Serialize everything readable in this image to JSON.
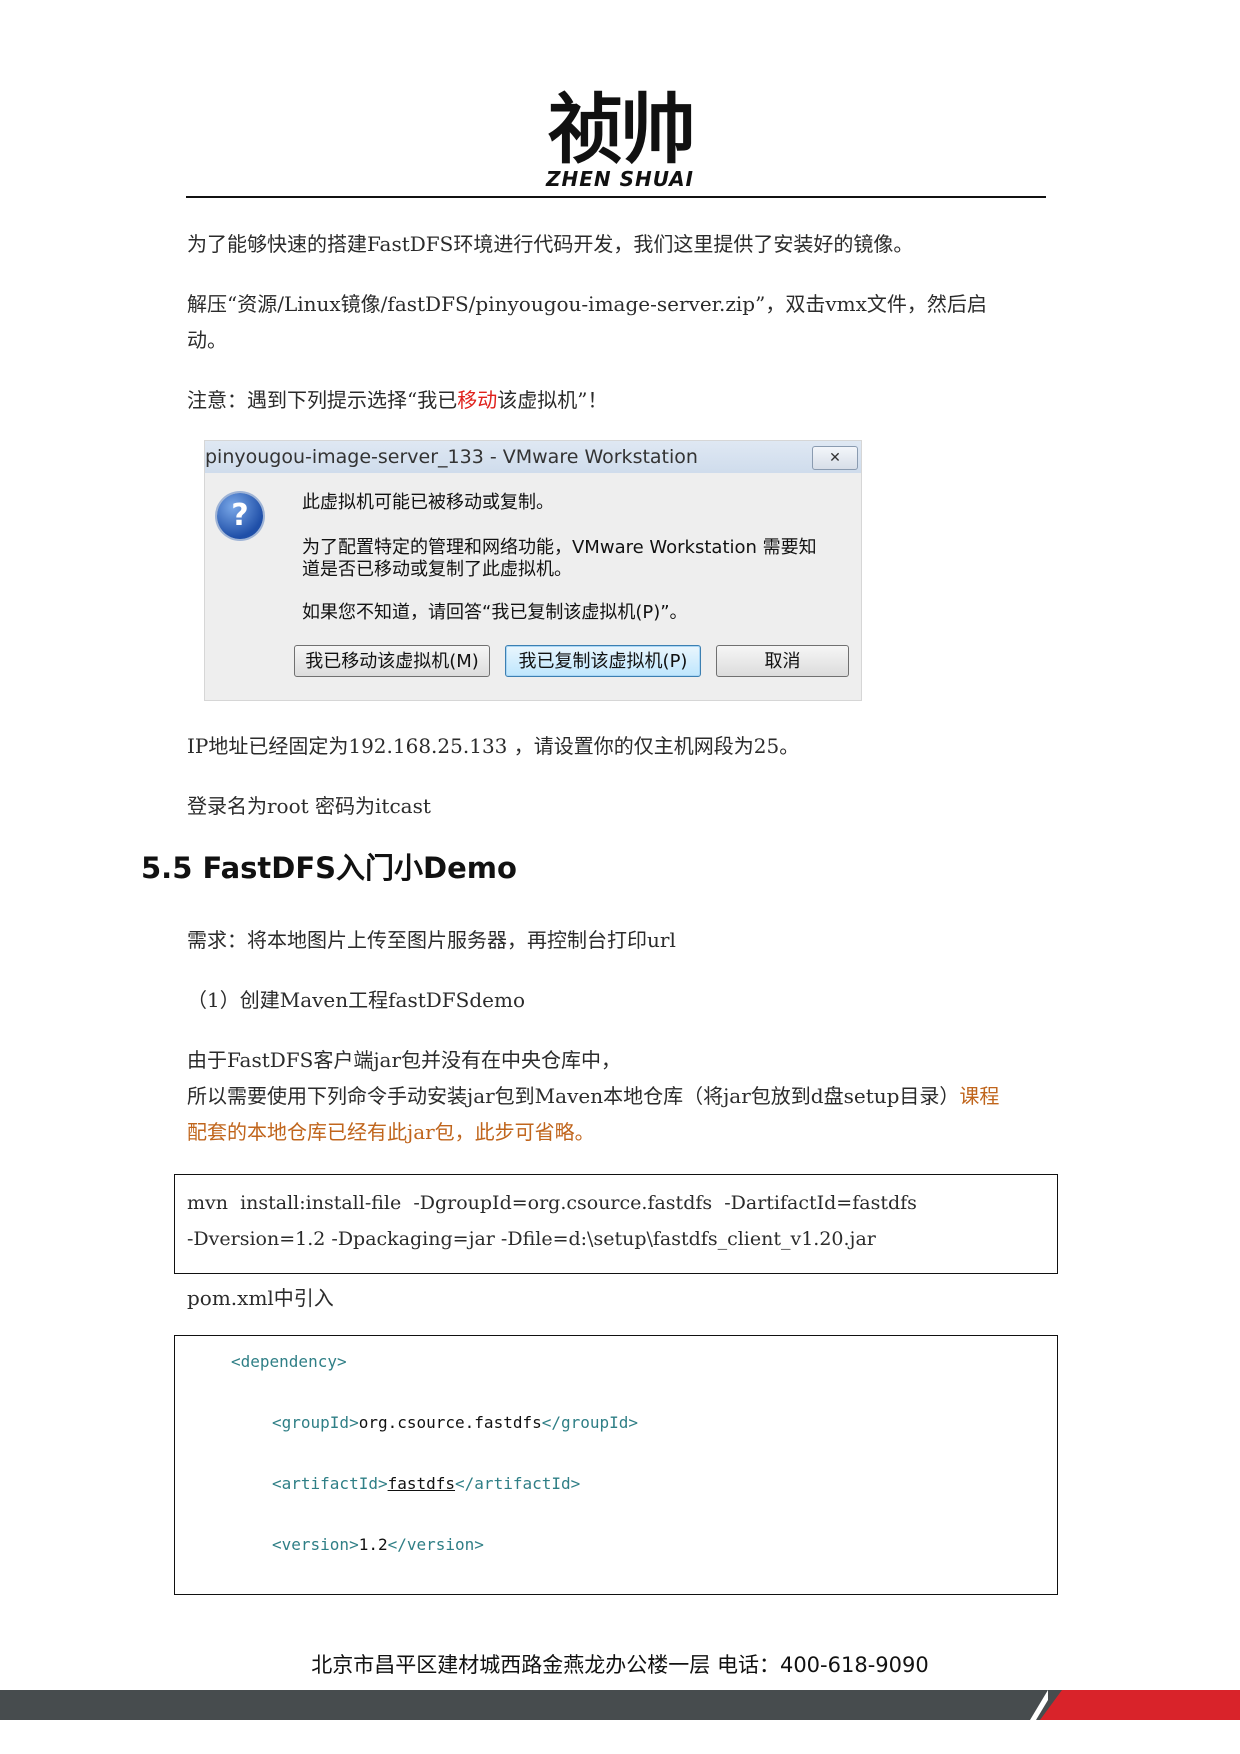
{
  "header": {
    "logo_cn": "祯帅",
    "logo_en": "ZHEN SHUAI"
  },
  "paras": {
    "p1": "为了能够快速的搭建FastDFS环境进行代码开发，我们这里提供了安装好的镜像。",
    "p2a": "解压“资源/Linux镜像/fastDFS/pinyougou-image-server.zip”，双击vmx文件，然后启",
    "p2b": "动。",
    "p3_pre": "注意：遇到下列提示选择“我已",
    "p3_red": "移动",
    "p3_post": "该虚拟机”！",
    "p4": "IP地址已经固定为192.168.25.133  ，请设置你的仅主机网段为25。",
    "p5": "登录名为root  密码为itcast",
    "p6": "需求：将本地图片上传至图片服务器，再控制台打印url",
    "p7": "（1）创建Maven工程fastDFSdemo",
    "p8a": "由于FastDFS客户端jar包并没有在中央仓库中，",
    "p8b_pre": "所以需要使用下列命令手动安装jar包到Maven本地仓库（将jar包放到d盘setup目录）",
    "p8b_orange": "课程",
    "p8c_orange": "配套的本地仓库已经有此jar包，此步可省略。",
    "p9": "pom.xml中引入"
  },
  "section": {
    "heading": "5.5 FastDFS入门小Demo"
  },
  "dialog": {
    "title": "pinyougou-image-server_133 - VMware Workstation",
    "close": "✕",
    "icon": "?",
    "line1": "此虚拟机可能已被移动或复制。",
    "line2a": "为了配置特定的管理和网络功能，VMware Workstation 需要知",
    "line2b": "道是否已移动或复制了此虚拟机。",
    "line3": "如果您不知道，请回答“我已复制该虚拟机(P)”。",
    "btn_moved": "我已移动该虚拟机(M)",
    "btn_copied": "我已复制该虚拟机(P)",
    "btn_cancel": "取消"
  },
  "cmd": {
    "line1": "mvn  install:install-file  -DgroupId=org.csource.fastdfs  -DartifactId=fastdfs",
    "line2": "-Dversion=1.2 -Dpackaging=jar -Dfile=d:\\setup\\fastdfs_client_v1.20.jar"
  },
  "xml": {
    "dependency_open": "<dependency>",
    "groupId_open": "<groupId>",
    "groupId_value": "org.csource.fastdfs",
    "groupId_close": "</groupId>",
    "artifactId_open": "<artifactId>",
    "artifactId_value": "fastdfs",
    "artifactId_close": "</artifactId>",
    "version_open": "<version>",
    "version_value": "1.2",
    "version_close": "</version>"
  },
  "footer": {
    "address": "北京市昌平区建材城西路金燕龙办公楼一层   电话：400-618-9090"
  },
  "colors": {
    "accent_red": "#e0201b",
    "note_orange": "#c0651c",
    "xml_tag": "#2f7f86",
    "footer_gray": "#474c4e",
    "footer_red": "#d9232a"
  }
}
